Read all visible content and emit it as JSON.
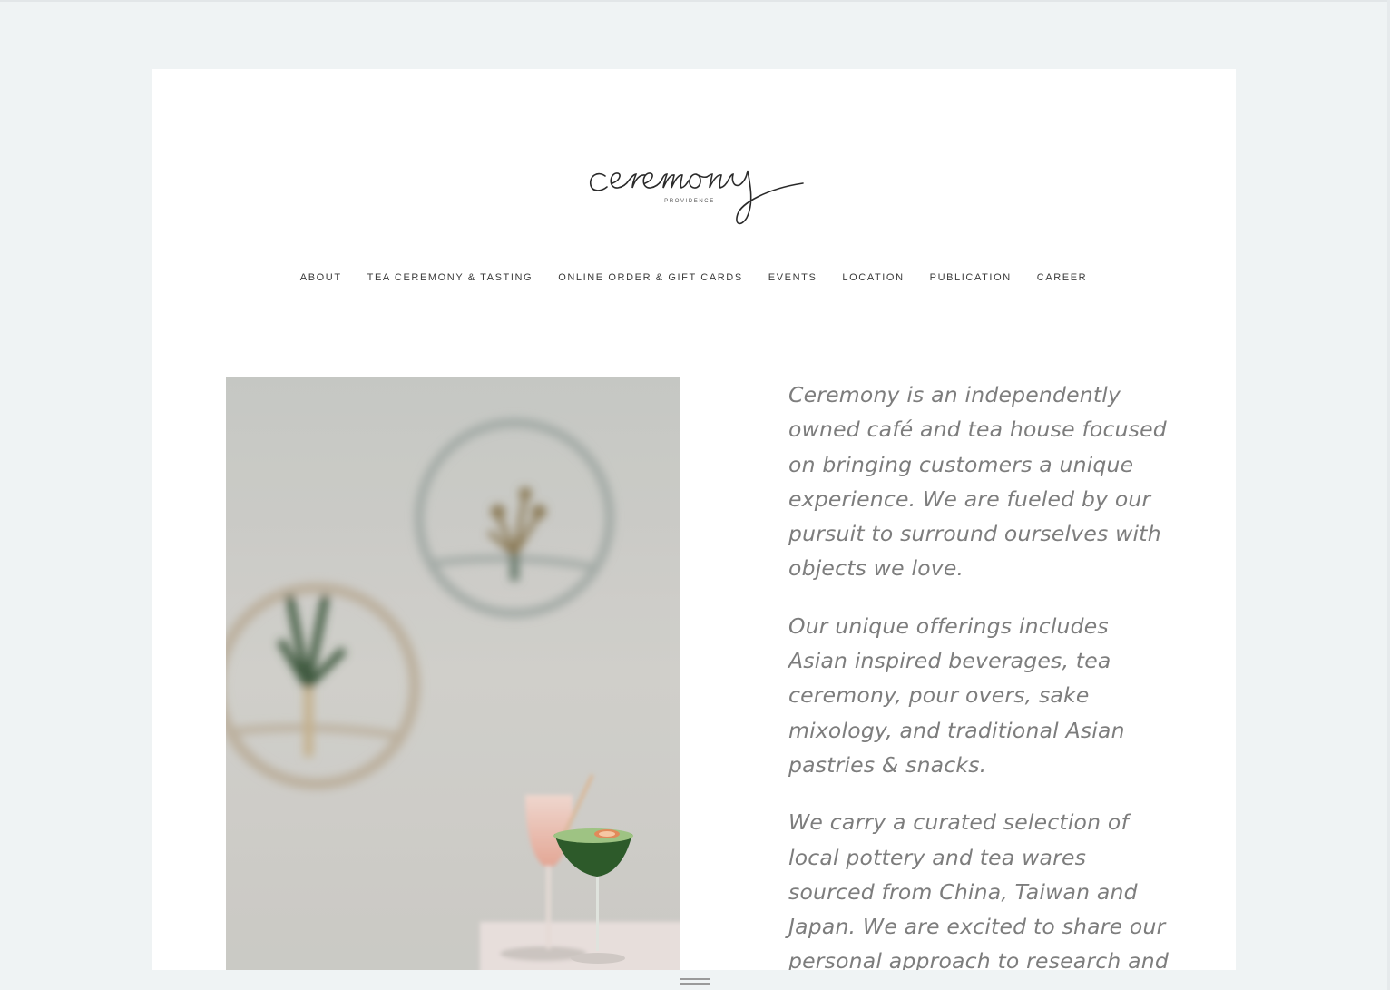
{
  "brand": {
    "logo_wordmark": "ceremony",
    "logo_subtitle": "PROVIDENCE"
  },
  "nav": {
    "items": [
      {
        "label": "ABOUT"
      },
      {
        "label": "TEA CEREMONY & TASTING"
      },
      {
        "label": "ONLINE ORDER & GIFT CARDS"
      },
      {
        "label": "EVENTS"
      },
      {
        "label": "LOCATION"
      },
      {
        "label": "PUBLICATION"
      },
      {
        "label": "CAREER"
      }
    ]
  },
  "intro": {
    "paragraphs": [
      "Ceremony is an independently owned café and tea house focused on bringing customers a unique experience. We are fueled by our pursuit to surround ourselves with objects we love.",
      "Our unique offerings includes Asian inspired beverages, tea ceremony, pour overs, sake mixology, and traditional Asian pastries & snacks.",
      "We carry a curated selection of local pottery and tea wares sourced from China, Taiwan and Japan. We are excited to share our personal approach to research and innovation with our guests."
    ]
  },
  "colors": {
    "page_background": "#eff3f4",
    "card_background": "#ffffff",
    "nav_text": "#3a3a3a",
    "body_text": "#7d7d7d"
  }
}
